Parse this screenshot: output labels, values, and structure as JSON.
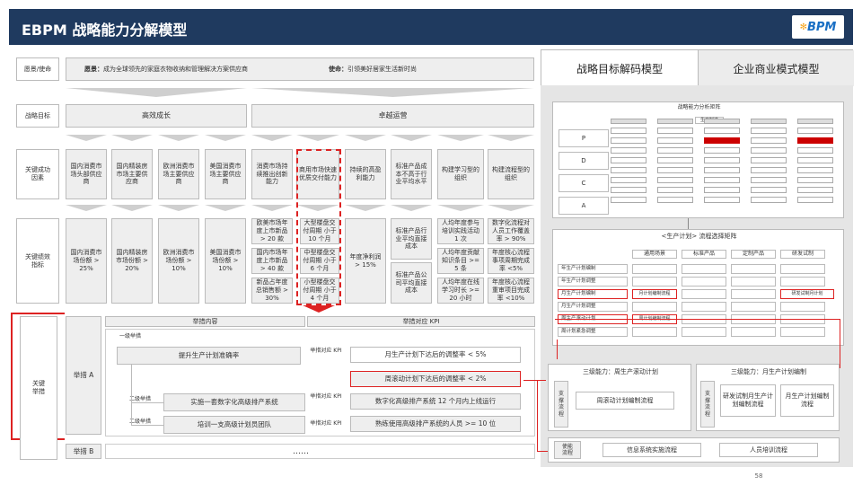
{
  "header": {
    "title": "EBPM 战略能力分解模型",
    "logo": "BPM",
    "logo_icon": "bpm-logo-icon"
  },
  "rows": {
    "vision_label": "愿景/使命",
    "vision_prefix": "愿景：",
    "vision_text": "成为全球领先的家庭衣物收纳和管理解决方案供应商",
    "mission_prefix": "使命：",
    "mission_text": "引领美好居家生活新时尚",
    "goal_label": "战略目标",
    "goal1": "高效成长",
    "goal2": "卓越运营",
    "csf_label": "关键成功因素",
    "kpi_label": "关键绩效指标"
  },
  "csf": [
    "国内消费市场头部供应商",
    "国内精装房市场主要供应商",
    "欧洲消费市场主要供应商",
    "美国消费市场主要供应商",
    "消费市场持续推出创新能力",
    "商用市场快速优质交付能力",
    "持续的高盈利能力",
    "标准产品成本不高于行业平均水平",
    "构建学习型的组织",
    "构建流程型的组织"
  ],
  "kpi": {
    "c1": "国内消费市场份额 > 25%",
    "c2": "国内精装房市场份额 > 20%",
    "c3": "欧洲消费市场份额 > 10%",
    "c4": "美国消费市场份额 > 10%",
    "c5a": "欧美市场年度上市新品 > 20 款",
    "c5b": "国内市场年度上市新品 > 40 款",
    "c5c": "新品占年度总销售额 > 30%",
    "c6a": "大型楼盘交付周期 小于 10 个月",
    "c6b": "中型楼盘交付周期 小于 6 个月",
    "c6c": "小型楼盘交付周期 小于 4 个月",
    "c7": "年度净利润 > 15%",
    "c8a": "标准产品行业平均直接成本",
    "c8b": "标准产品公司平均直接成本",
    "c9a": "人均年度参与培训实践活动 1 次",
    "c9b": "人均年度贡献知识条目 >= 5 条",
    "c9c": "人均年度在线学习时长 >= 20 小时",
    "c10a": "数字化流程对人员工作覆盖率 > 90%",
    "c10b": "年度核心流程事项周期完成率 <5%",
    "c10c": "年度核心流程重审项目完成率 <10%"
  },
  "measures": {
    "side_label": "关键举措",
    "h1": "举措内容",
    "h2": "举措对应 KPI",
    "row_a": "举措 A",
    "row_b": "举措 B",
    "l1": "一级举措",
    "l2a": "二级举措",
    "l2b": "二级举措",
    "kpi_tag": "举措对应 KPI",
    "m1": "提升生产计划准确率",
    "m2": "实施一套数字化高级排产系统",
    "m3": "培训一支高级计划员团队",
    "k1": "月生产计划下达后的调整率 < 5%",
    "k2": "周滚动计划下达后的调整率 < 2%",
    "k3": "数字化高级排产系统 12 个月内上线运行",
    "k4": "熟练使用高级排产系统的人员 >= 10 位",
    "dots": "……"
  },
  "tabs": {
    "t1": "战略目标解码模型",
    "t2": "企业商业模式模型"
  },
  "panel": {
    "mini_title": "战略能力分析矩阵",
    "mini_tag": "生产制造",
    "letters": [
      "P",
      "D",
      "C",
      "A"
    ],
    "matrix_title": "<生产计划> 流程选择矩阵",
    "cols": [
      "通用场景",
      "标准产品",
      "定制产品",
      "研发试制"
    ],
    "rows": [
      "年生产计划编制",
      "年生产计划调整",
      "月生产计划编制",
      "月生产计划调整",
      "周生产滚动计划",
      "周计划紧急调整"
    ],
    "cell_m": "月计划编制流程",
    "cell_r": "研发试制月计划",
    "cell_w": "周计划编制流程",
    "l3a_title": "三级能力：周生产滚动计划",
    "l3a_side": "支撑流程",
    "l3a_box": "周滚动计划编制流程",
    "l3b_title": "三级能力：月生产计划编制",
    "l3b_side": "支撑流程",
    "l3b_box1": "研发试制月生产计划编制流程",
    "l3b_box2": "月生产计划编制流程",
    "enable_side": "使能流程",
    "e1": "信息系统实施流程",
    "e2": "人员培训流程"
  },
  "page_number": "58"
}
